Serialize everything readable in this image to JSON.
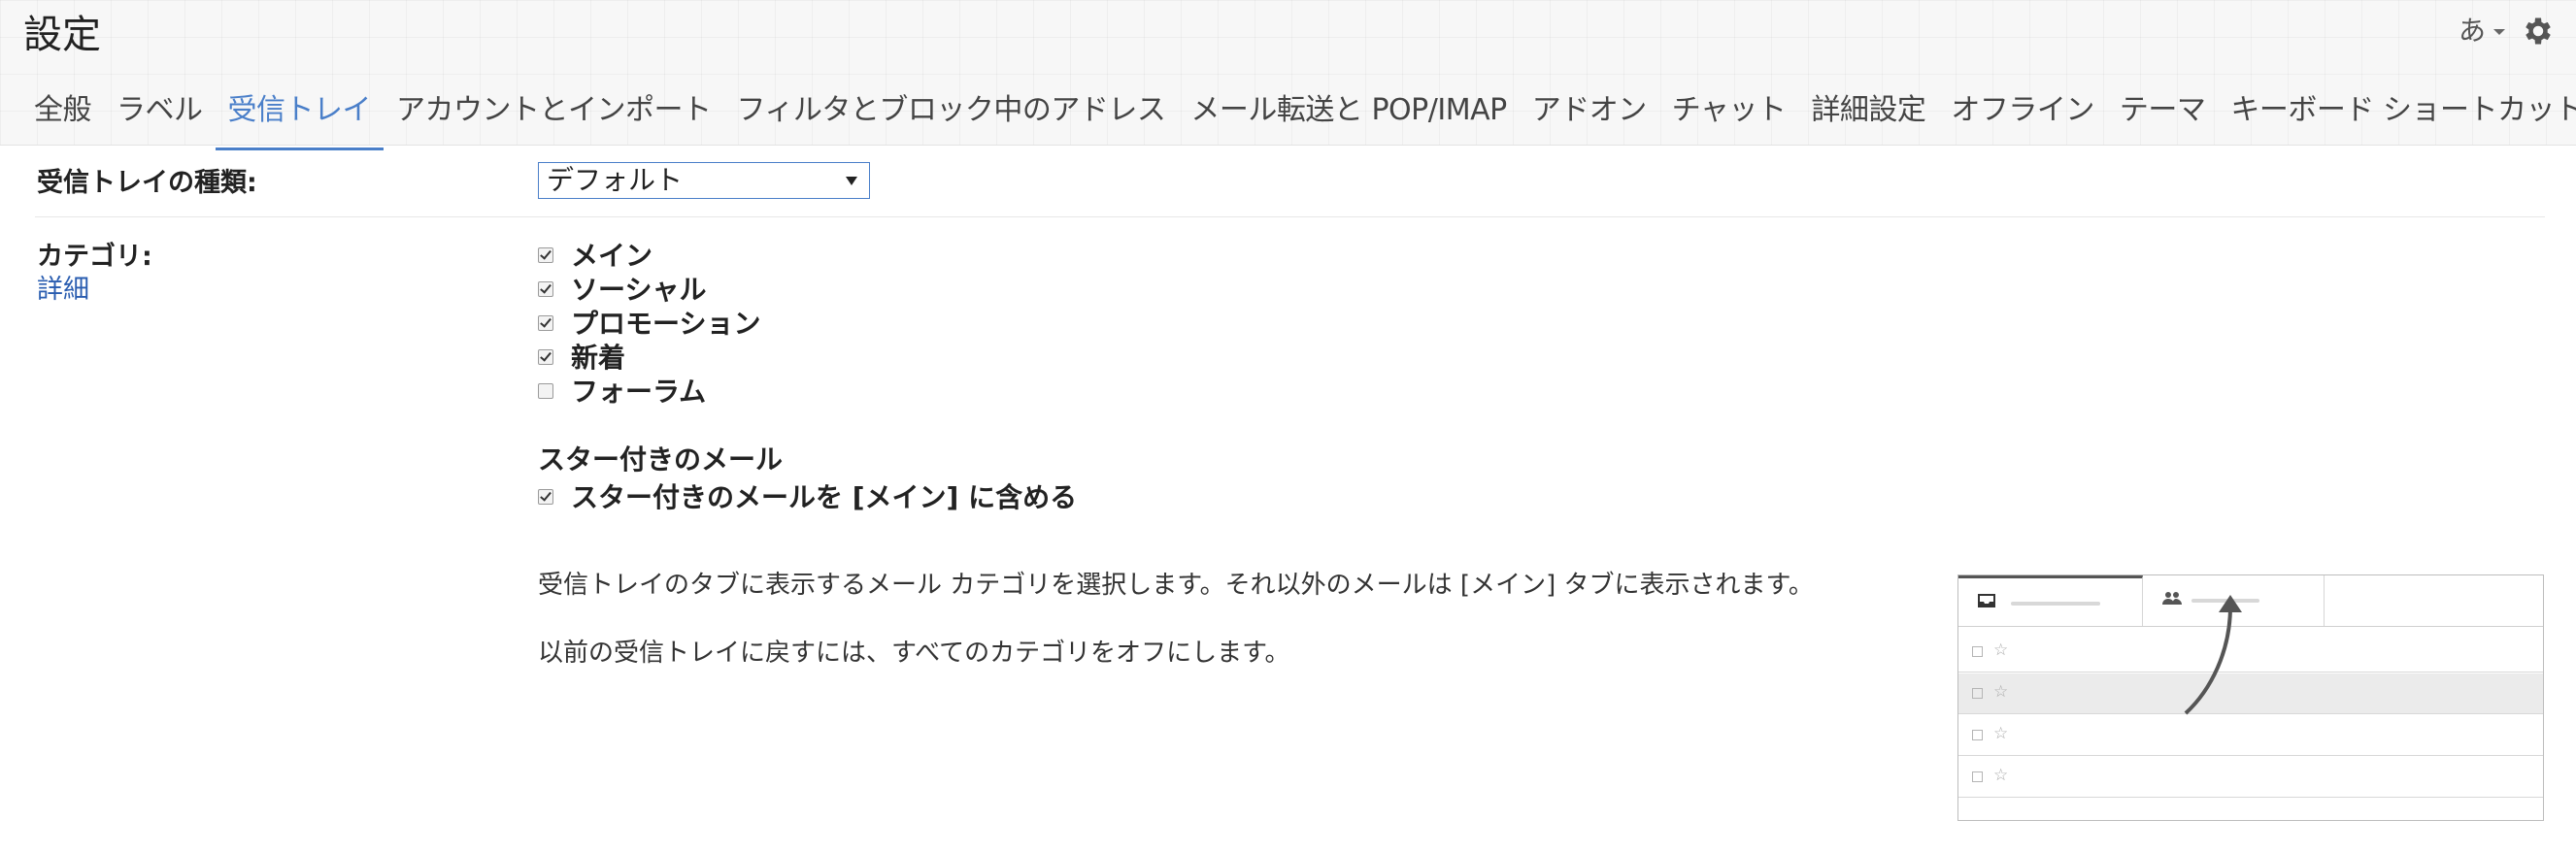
{
  "header": {
    "title": "設定",
    "ime_label": "あ",
    "icons": {
      "settings": "gear-icon",
      "ime_dropdown": "chevron-down-icon"
    }
  },
  "tabs": [
    {
      "label": "全般",
      "active": false
    },
    {
      "label": "ラベル",
      "active": false
    },
    {
      "label": "受信トレイ",
      "active": true
    },
    {
      "label": "アカウントとインポート",
      "active": false
    },
    {
      "label": "フィルタとブロック中のアドレス",
      "active": false
    },
    {
      "label": "メール転送と POP/IMAP",
      "active": false
    },
    {
      "label": "アドオン",
      "active": false
    },
    {
      "label": "チャット",
      "active": false
    },
    {
      "label": "詳細設定",
      "active": false
    },
    {
      "label": "オフライン",
      "active": false
    },
    {
      "label": "テーマ",
      "active": false
    },
    {
      "label": "キーボード ショートカット",
      "active": false
    }
  ],
  "inbox_type": {
    "label": "受信トレイの種類:",
    "selected": "デフォルト"
  },
  "categories": {
    "label": "カテゴリ:",
    "details_link": "詳細",
    "items": [
      {
        "label": "メイン",
        "checked": true
      },
      {
        "label": "ソーシャル",
        "checked": true
      },
      {
        "label": "プロモーション",
        "checked": true
      },
      {
        "label": "新着",
        "checked": true
      },
      {
        "label": "フォーラム",
        "checked": false
      }
    ],
    "starred_heading": "スター付きのメール",
    "starred_option": {
      "label": "スター付きのメールを [メイン] に含める",
      "checked": true
    },
    "description_1": "受信トレイのタブに表示するメール カテゴリを選択します。それ以外のメールは [メイン] タブに表示されます。",
    "description_2": "以前の受信トレイに戻すには、すべてのカテゴリをオフにします。"
  },
  "preview": {
    "tab_icons": [
      "inbox-icon",
      "people-icon"
    ],
    "row_star": "☆"
  },
  "colors": {
    "accent": "#4a7fc9",
    "link": "#2a5db0",
    "text": "#222222"
  }
}
